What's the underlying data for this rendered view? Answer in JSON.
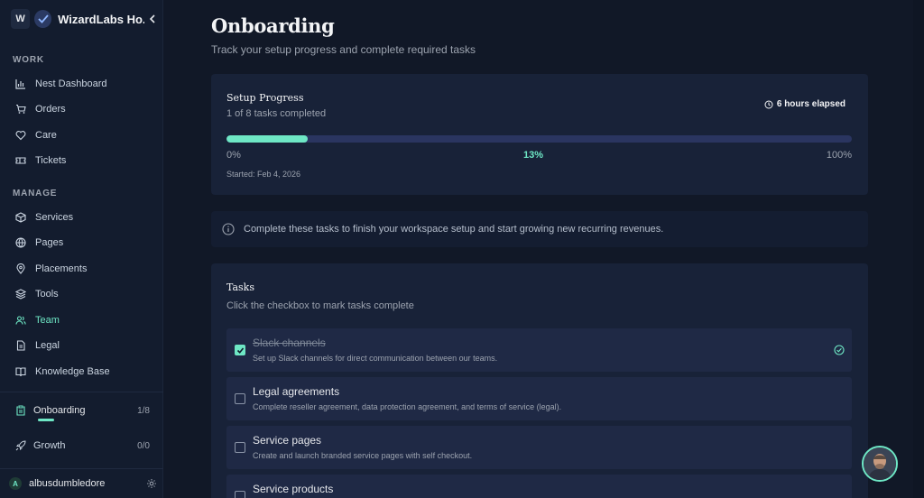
{
  "workspace": {
    "initial": "W",
    "name": "WizardLabs Ho..."
  },
  "sidebar": {
    "sections": [
      {
        "label": "WORK"
      },
      {
        "label": "MANAGE"
      }
    ],
    "work_items": [
      {
        "label": "Nest Dashboard",
        "icon": "chart-bars-icon"
      },
      {
        "label": "Orders",
        "icon": "cart-icon"
      },
      {
        "label": "Care",
        "icon": "heart-icon"
      },
      {
        "label": "Tickets",
        "icon": "ticket-icon"
      }
    ],
    "manage_items": [
      {
        "label": "Services",
        "icon": "cube-icon"
      },
      {
        "label": "Pages",
        "icon": "globe-icon"
      },
      {
        "label": "Placements",
        "icon": "map-pin-icon"
      },
      {
        "label": "Tools",
        "icon": "layers-icon"
      },
      {
        "label": "Team",
        "icon": "users-icon",
        "active": true
      },
      {
        "label": "Legal",
        "icon": "document-icon"
      },
      {
        "label": "Knowledge Base",
        "icon": "book-icon"
      }
    ],
    "progress_items": [
      {
        "label": "Onboarding",
        "count": "1/8",
        "progress": 0.125,
        "icon": "clipboard-icon"
      },
      {
        "label": "Growth",
        "count": "0/0",
        "icon": "rocket-icon"
      }
    ],
    "user": {
      "initial": "A",
      "name": "albusdumbledore"
    }
  },
  "page": {
    "title": "Onboarding",
    "subtitle": "Track your setup progress and complete required tasks"
  },
  "progress_card": {
    "title": "Setup Progress",
    "summary": "1 of 8 tasks completed",
    "elapsed": "6 hours elapsed",
    "percent": 13,
    "label_min": "0%",
    "label_pct": "13%",
    "label_max": "100%",
    "started": "Started: Feb 4, 2026"
  },
  "info": {
    "text": "Complete these tasks to finish your workspace setup and start growing new recurring revenues."
  },
  "tasks_card": {
    "title": "Tasks",
    "subtitle": "Click the checkbox to mark tasks complete",
    "tasks": [
      {
        "title": "Slack channels",
        "desc": "Set up Slack channels for direct communication between our teams.",
        "done": true
      },
      {
        "title": "Legal agreements",
        "desc": "Complete reseller agreement, data protection agreement, and terms of service (legal).",
        "done": false
      },
      {
        "title": "Service pages",
        "desc": "Create and launch branded service pages with self checkout.",
        "done": false
      },
      {
        "title": "Service products",
        "desc": "",
        "done": false
      }
    ]
  },
  "colors": {
    "accent": "#6ee7c5",
    "background": "#111827",
    "sidebar": "#131c2e",
    "card": "#182238"
  }
}
